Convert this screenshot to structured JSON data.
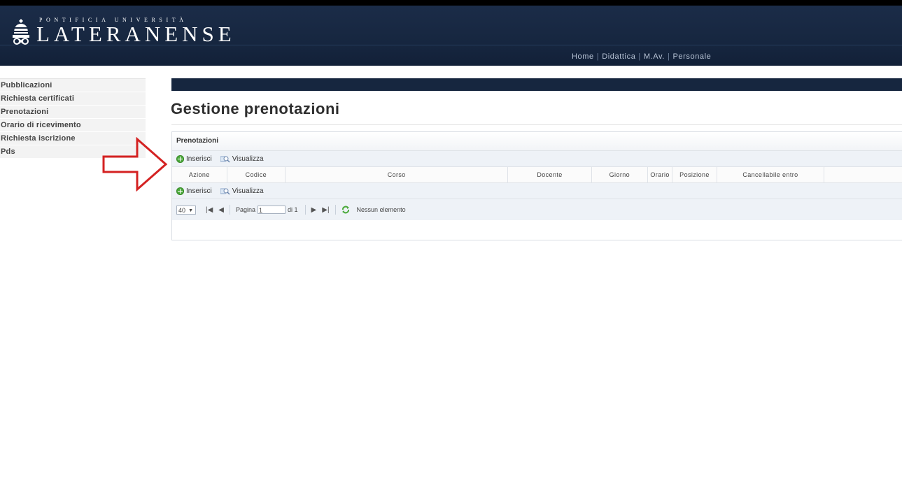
{
  "header": {
    "logo_small": "PONTIFICIA UNIVERSITÀ",
    "logo_big": "LATERANENSE",
    "nav": [
      "Home",
      "Didattica",
      "M.Av.",
      "Personale"
    ]
  },
  "sidebar": {
    "items": [
      {
        "label": "Pubblicazioni"
      },
      {
        "label": "Richiesta certificati"
      },
      {
        "label": "Prenotazioni"
      },
      {
        "label": "Orario di ricevimento"
      },
      {
        "label": "Richiesta iscrizione"
      },
      {
        "label": "Pds"
      }
    ]
  },
  "main": {
    "title": "Gestione prenotazioni",
    "panel_title": "Prenotazioni",
    "toolbar": {
      "insert": "Inserisci",
      "view": "Visualizza"
    },
    "columns": [
      "Azione",
      "Codice",
      "Corso",
      "Docente",
      "Giorno",
      "Orario",
      "Posizione",
      "Cancellabile entro",
      ""
    ],
    "pager": {
      "page_size": "40",
      "page_label": "Pagina",
      "page_value": "1",
      "of_label": "di 1",
      "status": "Nessun elemento"
    }
  },
  "colors": {
    "header_bg": "#16263f",
    "arrow_red": "#d42222",
    "insert_green": "#4caa3c"
  },
  "icons": {
    "insert": "plus-circle-icon",
    "view": "magnifier-icon",
    "first": "first-page-icon",
    "prev": "prev-page-icon",
    "next": "next-page-icon",
    "last": "last-page-icon",
    "refresh": "refresh-icon"
  }
}
